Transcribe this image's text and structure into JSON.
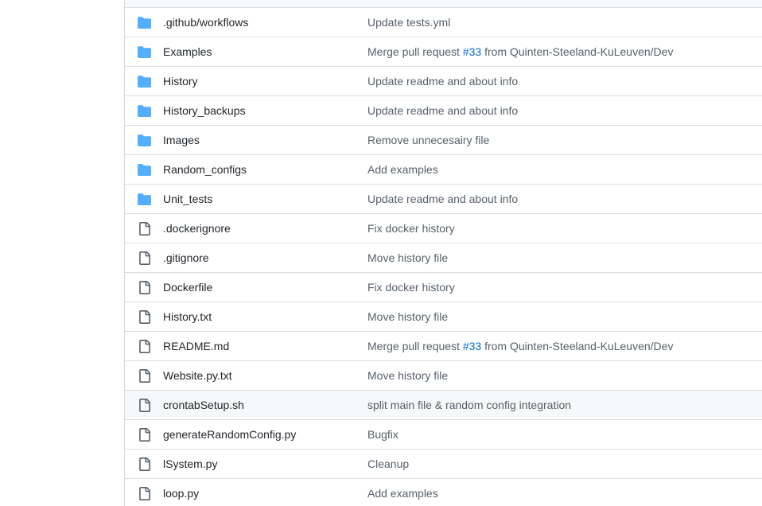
{
  "colors": {
    "folder": "#54aeff",
    "file": "#57606a",
    "link": "#0969da",
    "border": "#d8dee4",
    "hover_row": "#f6f8fa"
  },
  "files": [
    {
      "type": "folder",
      "icon": "folder-icon",
      "name": ".github/workflows",
      "message": "Update tests.yml"
    },
    {
      "type": "folder",
      "icon": "folder-icon",
      "name": "Examples",
      "message_pre": "Merge pull request ",
      "message_link": "#33",
      "message_post": " from Quinten-Steeland-KuLeuven/Dev"
    },
    {
      "type": "folder",
      "icon": "folder-icon",
      "name": "History",
      "message": "Update readme and about info"
    },
    {
      "type": "folder",
      "icon": "folder-icon",
      "name": "History_backups",
      "message": "Update readme and about info"
    },
    {
      "type": "folder",
      "icon": "folder-icon",
      "name": "Images",
      "message": "Remove unnecesairy file"
    },
    {
      "type": "folder",
      "icon": "folder-icon",
      "name": "Random_configs",
      "message": "Add examples"
    },
    {
      "type": "folder",
      "icon": "folder-icon",
      "name": "Unit_tests",
      "message": "Update readme and about info"
    },
    {
      "type": "file",
      "icon": "file-icon",
      "name": ".dockerignore",
      "message": "Fix docker history"
    },
    {
      "type": "file",
      "icon": "file-icon",
      "name": ".gitignore",
      "message": "Move history file"
    },
    {
      "type": "file",
      "icon": "file-icon",
      "name": "Dockerfile",
      "message": "Fix docker history"
    },
    {
      "type": "file",
      "icon": "file-icon",
      "name": "History.txt",
      "message": "Move history file"
    },
    {
      "type": "file",
      "icon": "file-icon",
      "name": "README.md",
      "message_pre": "Merge pull request ",
      "message_link": "#33",
      "message_post": " from Quinten-Steeland-KuLeuven/Dev"
    },
    {
      "type": "file",
      "icon": "file-icon",
      "name": "Website.py.txt",
      "message": "Move history file"
    },
    {
      "type": "file",
      "icon": "file-icon",
      "name": "crontabSetup.sh",
      "message": "split main file & random config integration",
      "hovered": true
    },
    {
      "type": "file",
      "icon": "file-icon",
      "name": "generateRandomConfig.py",
      "message": "Bugfix"
    },
    {
      "type": "file",
      "icon": "file-icon",
      "name": "lSystem.py",
      "message": "Cleanup"
    },
    {
      "type": "file",
      "icon": "file-icon",
      "name": "loop.py",
      "message": "Add examples"
    }
  ]
}
